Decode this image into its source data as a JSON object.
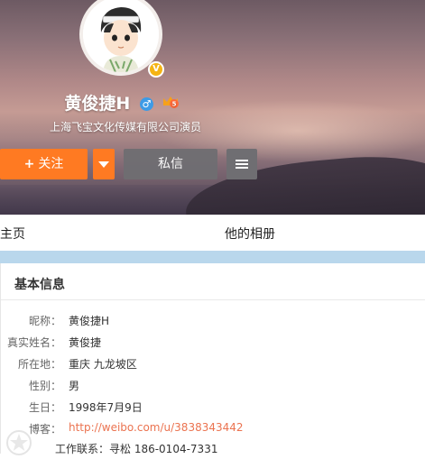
{
  "profile": {
    "name": "黄俊捷H",
    "gender_symbol": "♂",
    "verified_mark": "V",
    "subtitle": "上海飞宝文化传媒有限公司演员"
  },
  "actions": {
    "follow_label": "关注",
    "follow_plus": "+",
    "message_label": "私信"
  },
  "tabs": [
    {
      "label": "主页"
    },
    {
      "label": "他的相册"
    }
  ],
  "basic_info": {
    "title": "基本信息",
    "rows": [
      {
        "label": "昵称：",
        "value": "黄俊捷H"
      },
      {
        "label": "真实姓名：",
        "value": "黄俊捷"
      },
      {
        "label": "所在地：",
        "value": "重庆 九龙坡区"
      },
      {
        "label": "性别：",
        "value": "男"
      },
      {
        "label": "生日：",
        "value": "1998年7月9日"
      },
      {
        "label": "博客：",
        "value": "http://weibo.com/u/3838343442"
      },
      {
        "label": "",
        "value": "工作联系：寻松 186-0104-7331"
      }
    ]
  },
  "colors": {
    "accent_orange": "#ff7a22",
    "link": "#eb7350",
    "blue_divider": "#b9d7ec"
  }
}
